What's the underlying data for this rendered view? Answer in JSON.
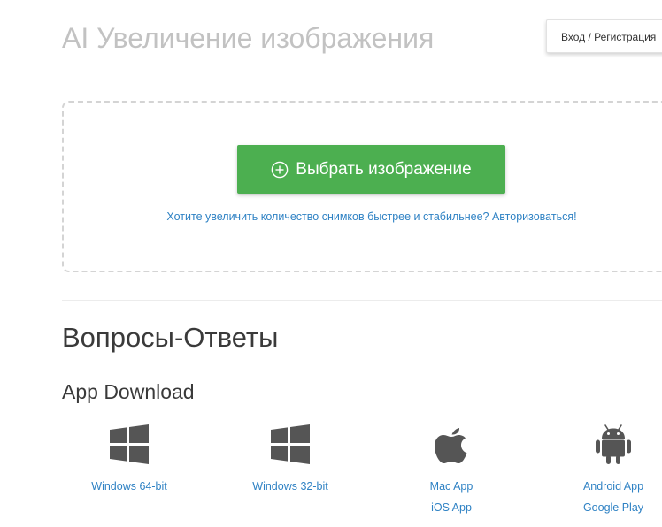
{
  "header": {
    "title": "AI Увеличение изображения",
    "login_label": "Вход / Регистрация"
  },
  "upload": {
    "button_label": "Выбрать изображение",
    "button_icon": "plus-circle-icon",
    "hint_text": "Хотите увеличить количество снимков быстрее и стабильнее? ",
    "hint_link": "Авторизоваться!"
  },
  "faq": {
    "heading": "Вопросы-Ответы"
  },
  "app_download": {
    "heading": "App Download",
    "apps": [
      {
        "icon": "windows-icon",
        "links": [
          "Windows 64-bit"
        ]
      },
      {
        "icon": "windows-icon",
        "links": [
          "Windows 32-bit"
        ]
      },
      {
        "icon": "apple-icon",
        "links": [
          "Mac App",
          "iOS App"
        ]
      },
      {
        "icon": "android-icon",
        "links": [
          "Android App",
          "Google Play"
        ]
      }
    ]
  },
  "colors": {
    "accent_green": "#4caf50",
    "link_blue": "#2f82c4",
    "title_gray": "#c2c2c2",
    "icon_gray": "#555555"
  }
}
